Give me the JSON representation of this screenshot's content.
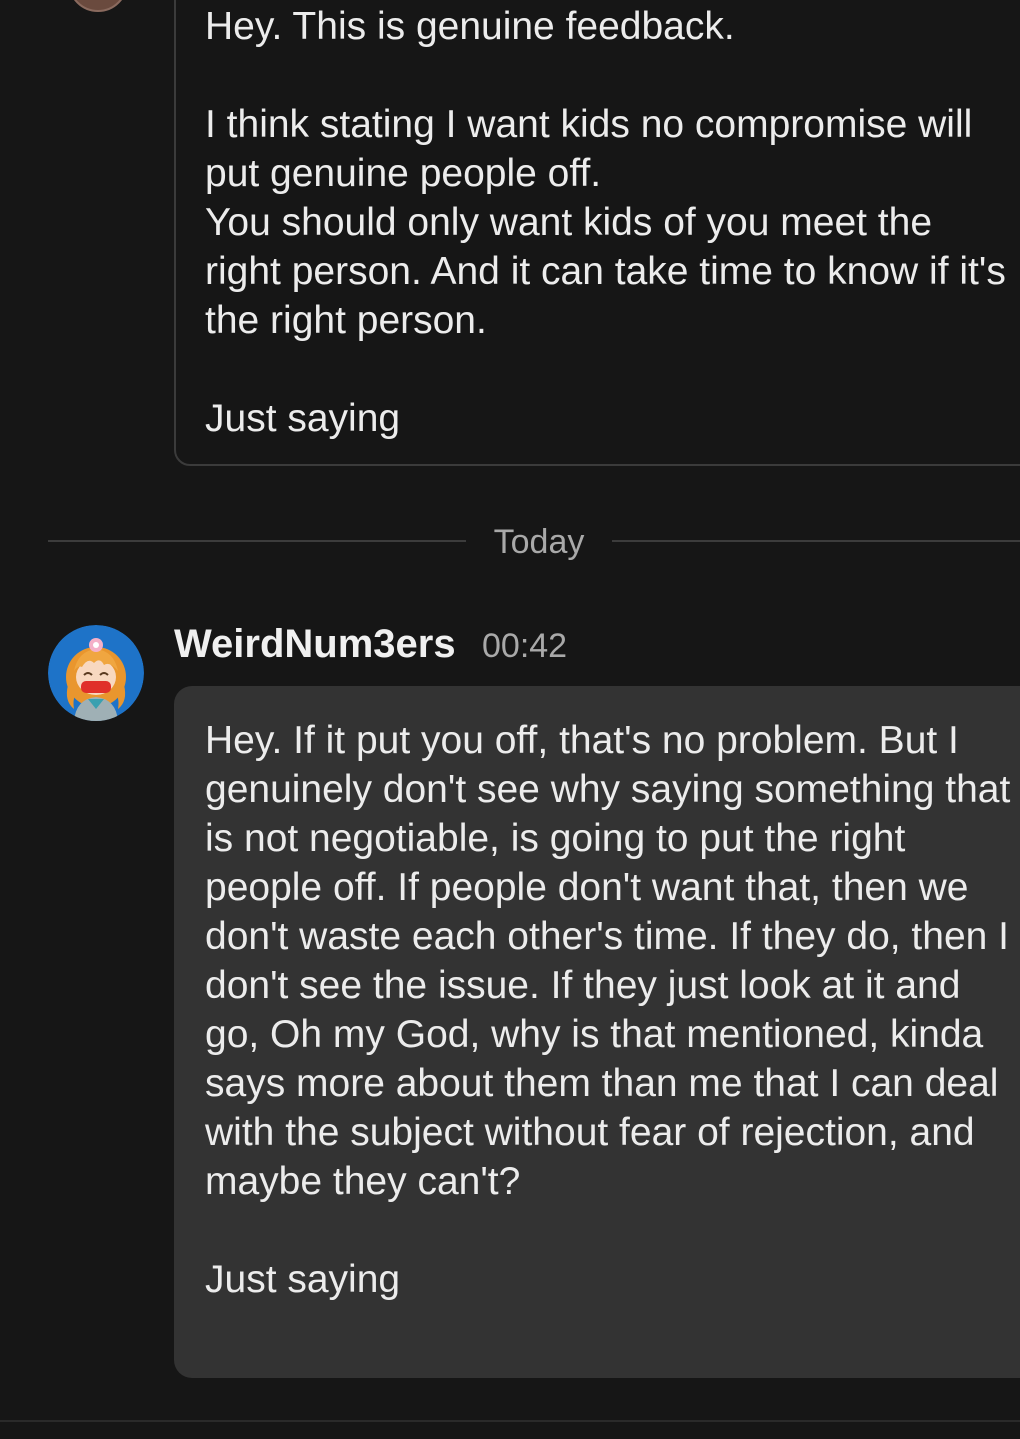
{
  "conversation": {
    "earlier_message": {
      "text": "Hey.   This is genuine feedback.\n\nI think stating I want kids no compromise will put genuine people off.\nYou should only want kids of you meet the right person.   And it can take time to know if it's the right person.\n\nJust saying"
    },
    "date_divider": {
      "label": "Today"
    },
    "latest_message": {
      "author": "WeirdNum3ers",
      "time": "00:42",
      "text": "Hey. If it put you off, that's no problem. But I genuinely don't see why saying something that is not negotiable, is going to put the right people off. If people don't want that, then we don't waste each other's time. If they do, then I don't see the issue. If they just look at it and go, Oh my God, why is that mentioned, kinda says more about them than me that I can deal with the subject without fear of rejection, and maybe they can't?\n\nJust saying"
    }
  },
  "colors": {
    "background": "#161616",
    "sent_bubble": "#333333",
    "received_border": "#3b3b3b",
    "avatar_ring": "#1e73c8"
  }
}
